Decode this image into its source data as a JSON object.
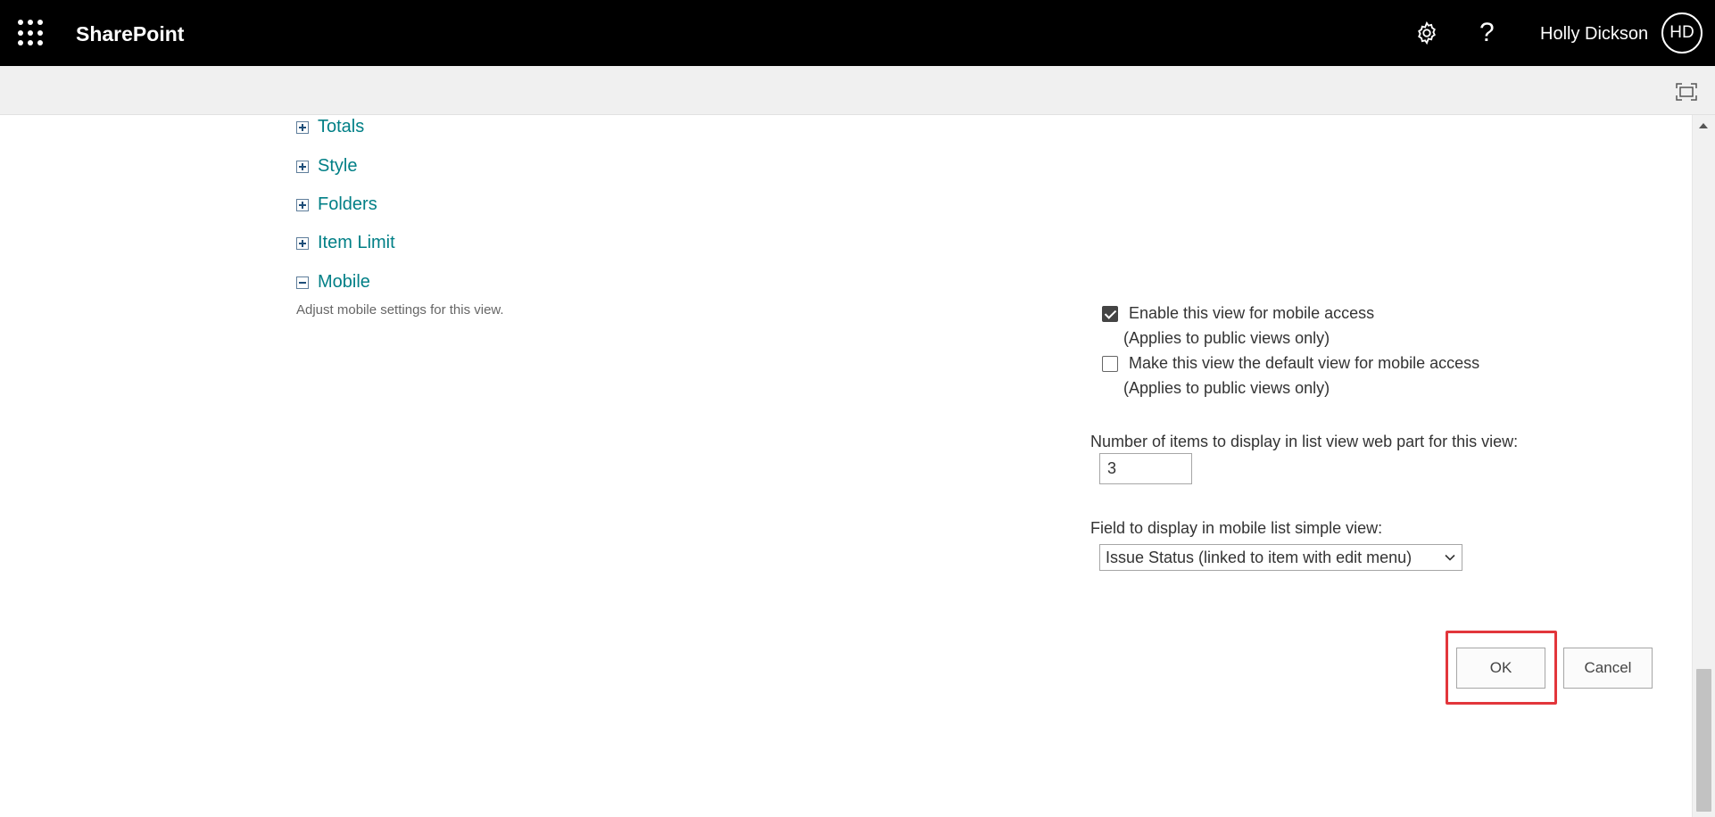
{
  "suitebar": {
    "app_name": "SharePoint",
    "settings_icon": "gear-icon",
    "help_icon": "help-icon",
    "help_glyph": "?",
    "user_name": "Holly Dickson",
    "user_initials": "HD",
    "bg_color": "#000000"
  },
  "commandbar": {
    "focus_icon": "focus-mode-icon"
  },
  "sections": [
    {
      "label": "Totals",
      "state": "collapsed"
    },
    {
      "label": "Style",
      "state": "collapsed"
    },
    {
      "label": "Folders",
      "state": "collapsed"
    },
    {
      "label": "Item Limit",
      "state": "collapsed"
    },
    {
      "label": "Mobile",
      "state": "expanded"
    }
  ],
  "mobile": {
    "description": "Adjust mobile settings for this view.",
    "enable_mobile": {
      "label": "Enable this view for mobile access",
      "note": "(Applies to public views only)",
      "checked": true
    },
    "default_mobile": {
      "label": "Make this view the default view for mobile access",
      "note": "(Applies to public views only)",
      "checked": false
    },
    "items_label": "Number of items to display in list view web part for this view:",
    "items_value": "3",
    "field_label": "Field to display in mobile list simple view:",
    "field_value": "Issue Status (linked to item with edit menu)"
  },
  "buttons": {
    "ok_label": "OK",
    "cancel_label": "Cancel"
  },
  "colors": {
    "link": "#007f86",
    "highlight": "#e2363b"
  }
}
